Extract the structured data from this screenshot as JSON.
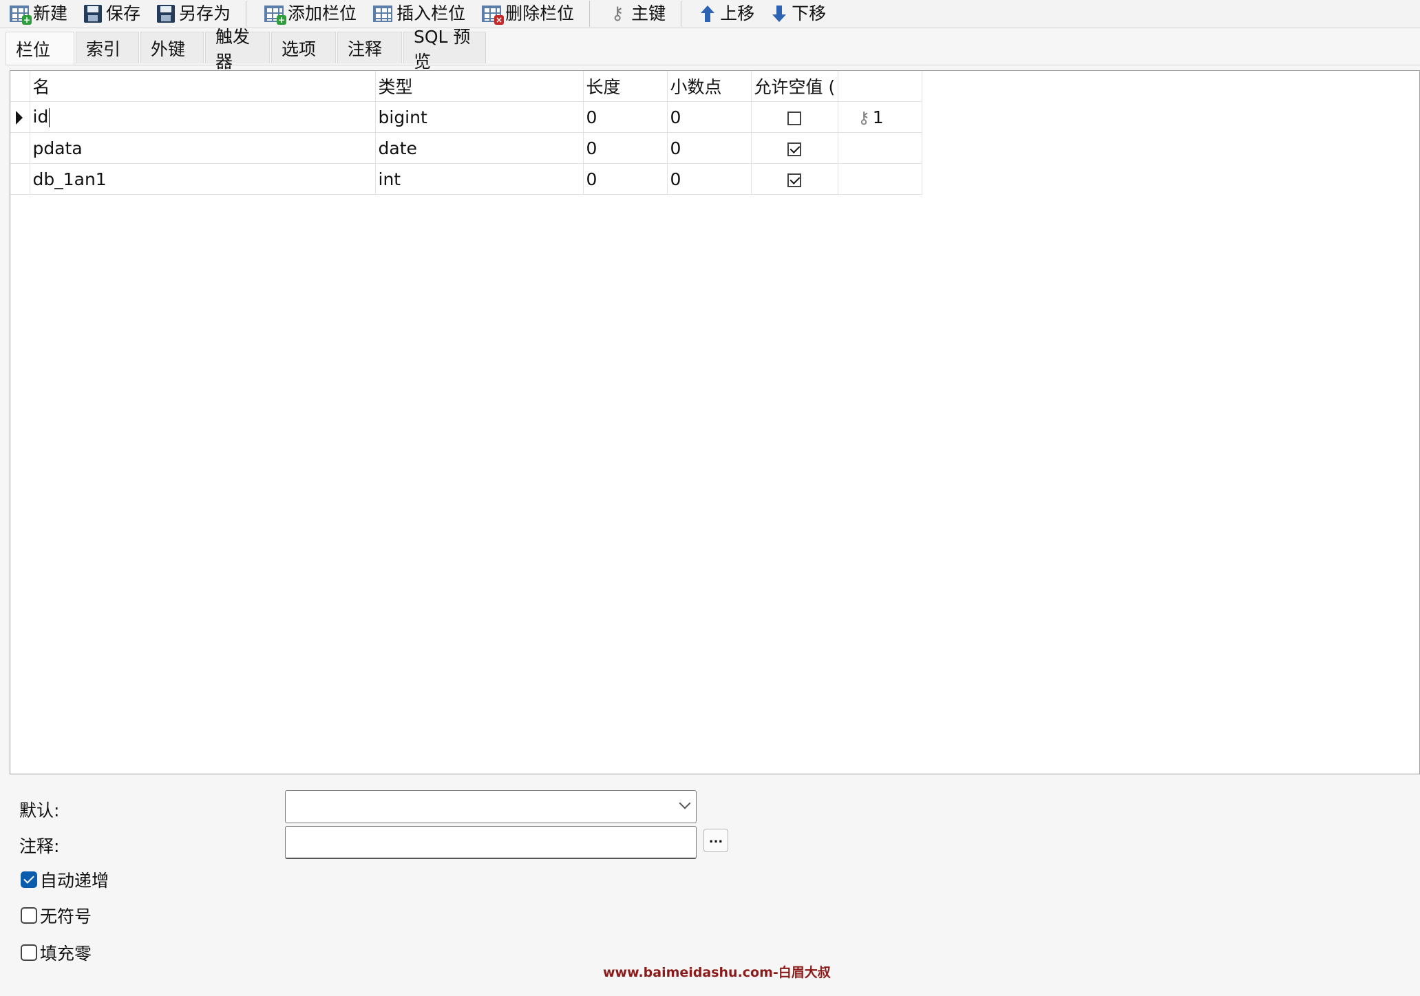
{
  "toolbar": {
    "new": "新建",
    "save": "保存",
    "save_as": "另存为",
    "add_field": "添加栏位",
    "insert_field": "插入栏位",
    "delete_field": "删除栏位",
    "primary_key": "主键",
    "move_up": "上移",
    "move_down": "下移"
  },
  "tabs": [
    "栏位",
    "索引",
    "外键",
    "触发器",
    "选项",
    "注释",
    "SQL 预览"
  ],
  "grid": {
    "headers": [
      "名",
      "类型",
      "长度",
      "小数点",
      "允许空值 ("
    ],
    "rows": [
      {
        "name": "id",
        "type": "bigint",
        "length": "0",
        "decimals": "0",
        "nullable": false,
        "key": "1"
      },
      {
        "name": "pdata",
        "type": "date",
        "length": "0",
        "decimals": "0",
        "nullable": true,
        "key": ""
      },
      {
        "name": "db_1an1",
        "type": "int",
        "length": "0",
        "decimals": "0",
        "nullable": true,
        "key": ""
      }
    ]
  },
  "props": {
    "default_label": "默认:",
    "default_value": "",
    "comment_label": "注释:",
    "comment_value": "",
    "ellipsis": "...",
    "auto_increment": {
      "label": "自动递增",
      "checked": true
    },
    "unsigned": {
      "label": "无符号",
      "checked": false
    },
    "zerofill": {
      "label": "填充零",
      "checked": false
    }
  },
  "watermark": "www.baimeidashu.com-白眉大叔",
  "colors": {
    "accent": "#0b5cad",
    "watermark": "#8b1a1a"
  }
}
